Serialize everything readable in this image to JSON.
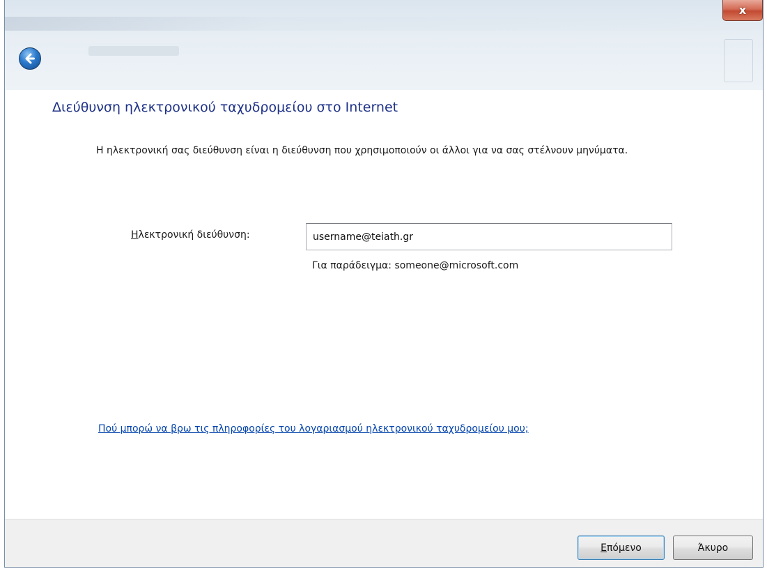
{
  "window": {
    "close_glyph": "x",
    "back_icon": "back-arrow-icon"
  },
  "page": {
    "title": "Διεύθυνση ηλεκτρονικού ταχυδρομείου στο Internet",
    "description": "Η ηλεκτρονική σας διεύθυνση είναι η διεύθυνση που χρησιμοποιούν οι άλλοι για να σας στέλνουν μηνύματα."
  },
  "form": {
    "email_label_accel": "Η",
    "email_label_rest": "λεκτρονική διεύθυνση:",
    "email_value": "username@teiath.gr",
    "example_hint": "Για παράδειγμα: someone@microsoft.com"
  },
  "help": {
    "link_text": "Πού μπορώ να βρω τις πληροφορίες του λογαριασμού ηλεκτρονικού ταχυδρομείου μου;"
  },
  "buttons": {
    "next_accel": "Ε",
    "next_rest": "πόμενο",
    "cancel_label": "Άκυρο"
  },
  "colors": {
    "title": "#1e3287",
    "link": "#0645ad",
    "footer_bg": "#f0f0f0",
    "close_button": "#c24a32"
  }
}
